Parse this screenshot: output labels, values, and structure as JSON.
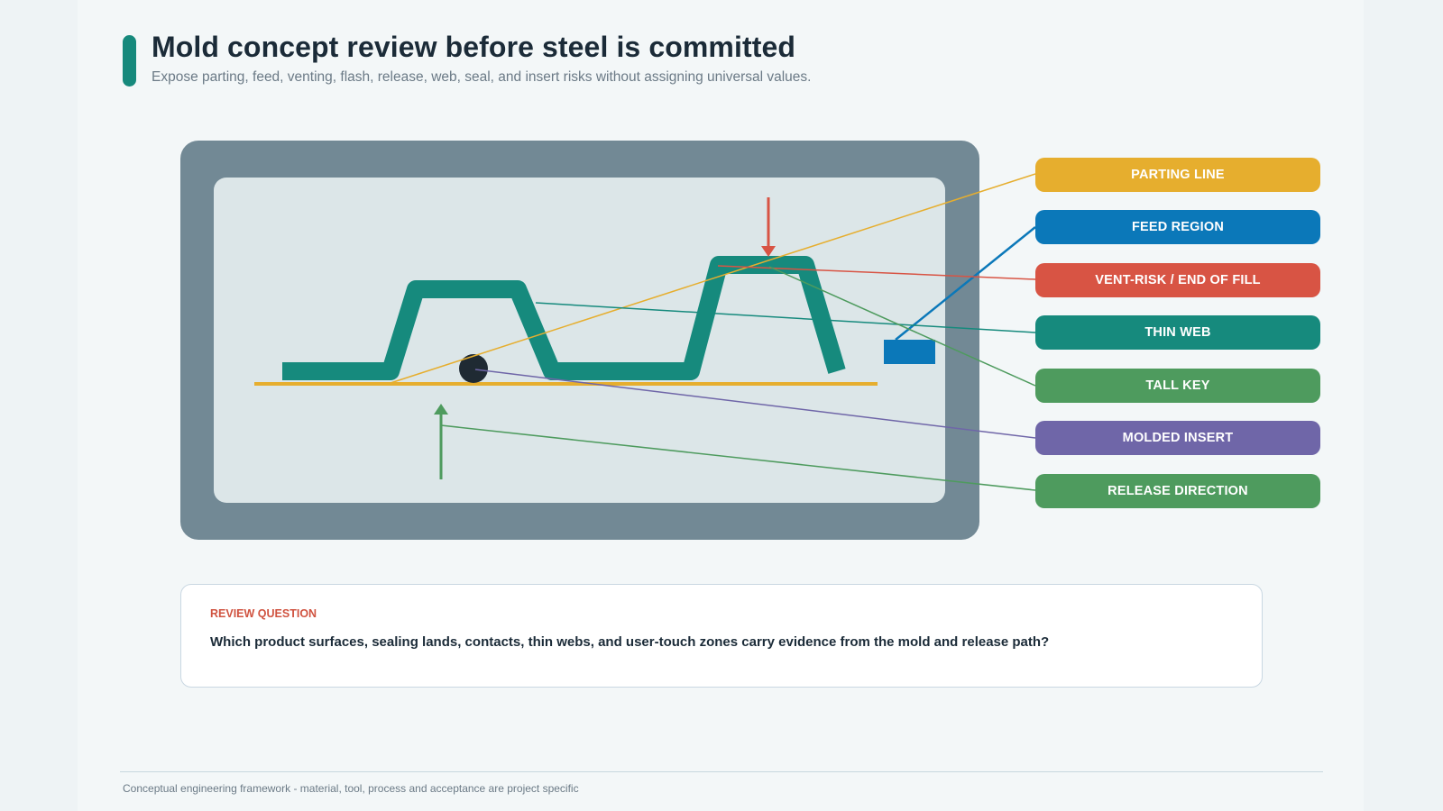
{
  "header": {
    "title": "Mold concept review before steel is committed",
    "subtitle": "Expose parting, feed, venting, flash, release, web, seal, and insert risks without assigning universal values."
  },
  "callouts": [
    {
      "id": "parting-line",
      "label": "PARTING LINE",
      "color": "#e6ae2e"
    },
    {
      "id": "feed-region",
      "label": "FEED REGION",
      "color": "#0b78b9"
    },
    {
      "id": "vent-risk",
      "label": "VENT-RISK / END OF FILL",
      "color": "#d85444"
    },
    {
      "id": "thin-web",
      "label": "THIN WEB",
      "color": "#168a7d"
    },
    {
      "id": "tall-key",
      "label": "TALL KEY",
      "color": "#4e9b5e"
    },
    {
      "id": "molded-insert",
      "label": "MOLDED INSERT",
      "color": "#6f66a8"
    },
    {
      "id": "release-direction",
      "label": "RELEASE DIRECTION",
      "color": "#4e9b5e"
    }
  ],
  "colors": {
    "accent": "#16897c",
    "mold_frame": "#728995",
    "cavity": "#dce6e8",
    "part": "#168a7d",
    "parting_line": "#e6ae2e",
    "feed": "#0b78b9",
    "vent": "#d85444",
    "release": "#4e9b5e",
    "insert": "#1f2a33"
  },
  "review": {
    "kicker": "REVIEW QUESTION",
    "question": "Which product surfaces, sealing lands, contacts, thin webs, and user-touch zones carry evidence from the mold and release path?"
  },
  "footer": {
    "note": "Conceptual engineering framework - material, tool, process and acceptance are project specific"
  }
}
